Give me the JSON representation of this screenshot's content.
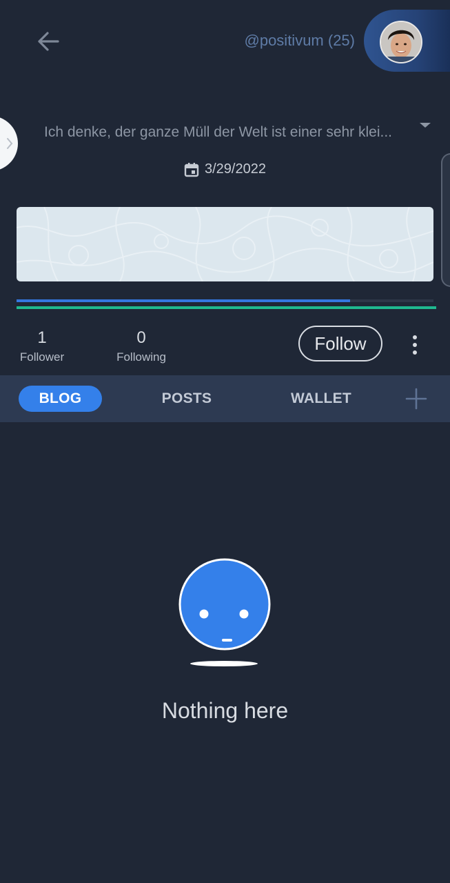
{
  "header": {
    "username": "@positivum (25)",
    "back_icon": "arrow-left-icon",
    "avatar_icon": "user-avatar"
  },
  "profile": {
    "about": "Ich denke, der ganze Müll der Welt ist einer sehr klei...",
    "date": "3/29/2022",
    "voting_power": 0.8,
    "resource_credits": 1.0
  },
  "stats": {
    "followers_count": "1",
    "followers_label": "Follower",
    "following_count": "0",
    "following_label": "Following"
  },
  "actions": {
    "follow_label": "Follow",
    "more_icon": "more-vertical-icon"
  },
  "tabs": [
    {
      "label": "BLOG",
      "active": true
    },
    {
      "label": "POSTS",
      "active": false
    },
    {
      "label": "WALLET",
      "active": false
    }
  ],
  "empty_state": {
    "text": "Nothing here"
  },
  "colors": {
    "background": "#1f2736",
    "tabbar": "#2d3a52",
    "accent": "#3480ea",
    "green": "#1fb98f"
  }
}
